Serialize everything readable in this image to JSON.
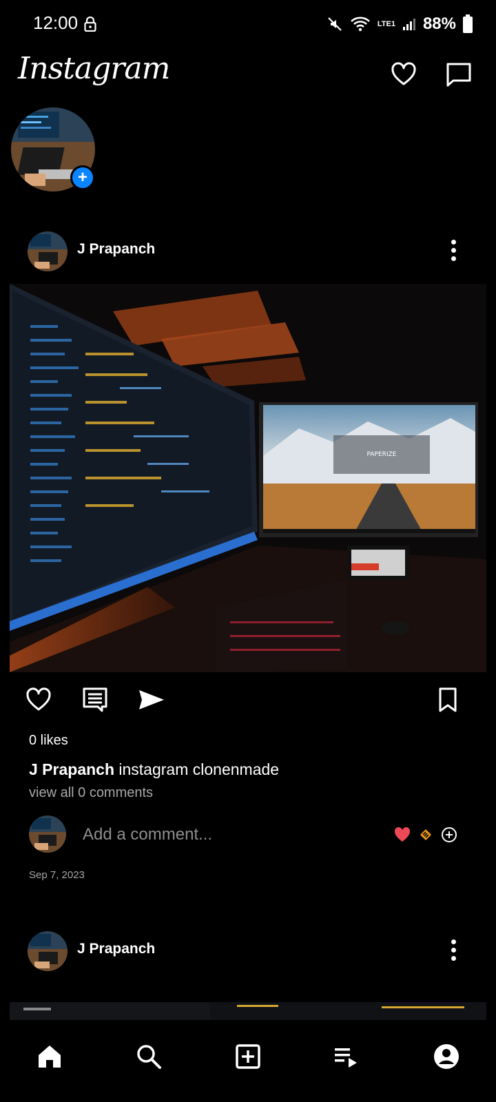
{
  "status_bar": {
    "time": "12:00",
    "battery": "88%",
    "network": "LTE1"
  },
  "header": {
    "logo": "Instagram"
  },
  "story": {
    "add_icon": "+"
  },
  "posts": [
    {
      "username": "J Prapanch",
      "likes": "0 likes",
      "caption_user": "J Prapanch",
      "caption_text": "instagram clonenmade",
      "view_comments": "view all 0 comments",
      "comment_placeholder": "Add a comment...",
      "date": "Sep 7, 2023",
      "image_text": "PAPERIZE"
    },
    {
      "username": "J Prapanch"
    }
  ],
  "colors": {
    "background": "#000000",
    "accent_blue": "#0a84ff",
    "heart_red": "#ed4956",
    "muted_text": "#a8a8a8"
  },
  "icons": [
    "heart-icon",
    "messenger-icon",
    "comment-icon",
    "send-icon",
    "bookmark-icon",
    "home-icon",
    "search-icon",
    "add-post-icon",
    "reels-icon",
    "profile-icon"
  ]
}
